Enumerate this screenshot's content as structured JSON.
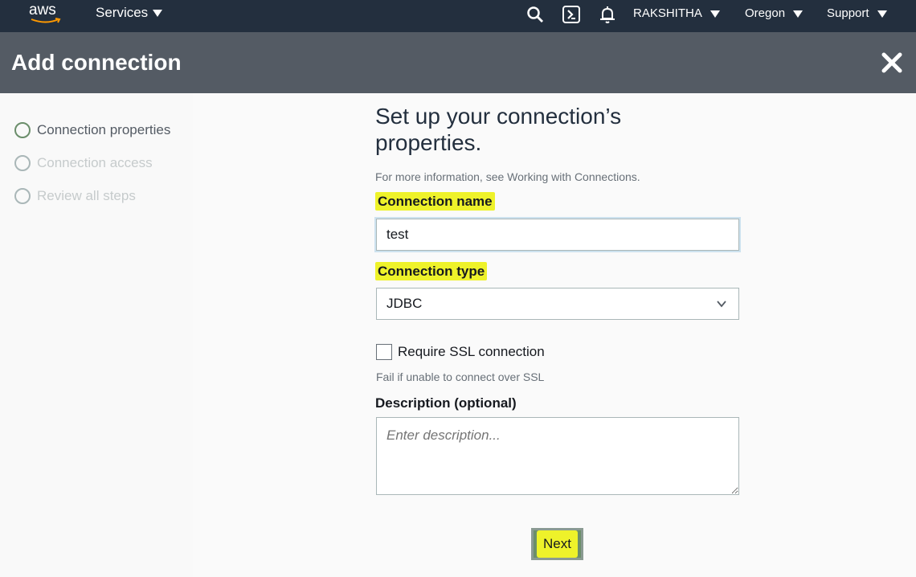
{
  "topbar": {
    "logo_text": "aws",
    "services_label": "Services",
    "user_label": "RAKSHITHA",
    "region_label": "Oregon",
    "support_label": "Support"
  },
  "header": {
    "title": "Add connection"
  },
  "steps": [
    {
      "label": "Connection properties",
      "state": "active"
    },
    {
      "label": "Connection access",
      "state": "inactive"
    },
    {
      "label": "Review all steps",
      "state": "inactive"
    }
  ],
  "form": {
    "heading": "Set up your connection’s properties.",
    "info": "For more information, see Working with Connections.",
    "connection_name_label": "Connection name",
    "connection_name_value": "test",
    "connection_type_label": "Connection type",
    "connection_type_value": "JDBC",
    "ssl_label": "Require SSL connection",
    "ssl_hint": "Fail if unable to connect over SSL",
    "description_label": "Description (optional)",
    "description_placeholder": "Enter description...",
    "next_label": "Next"
  },
  "colors": {
    "topbar": "#232f3e",
    "header": "#545b64",
    "highlight": "#eef22a"
  }
}
